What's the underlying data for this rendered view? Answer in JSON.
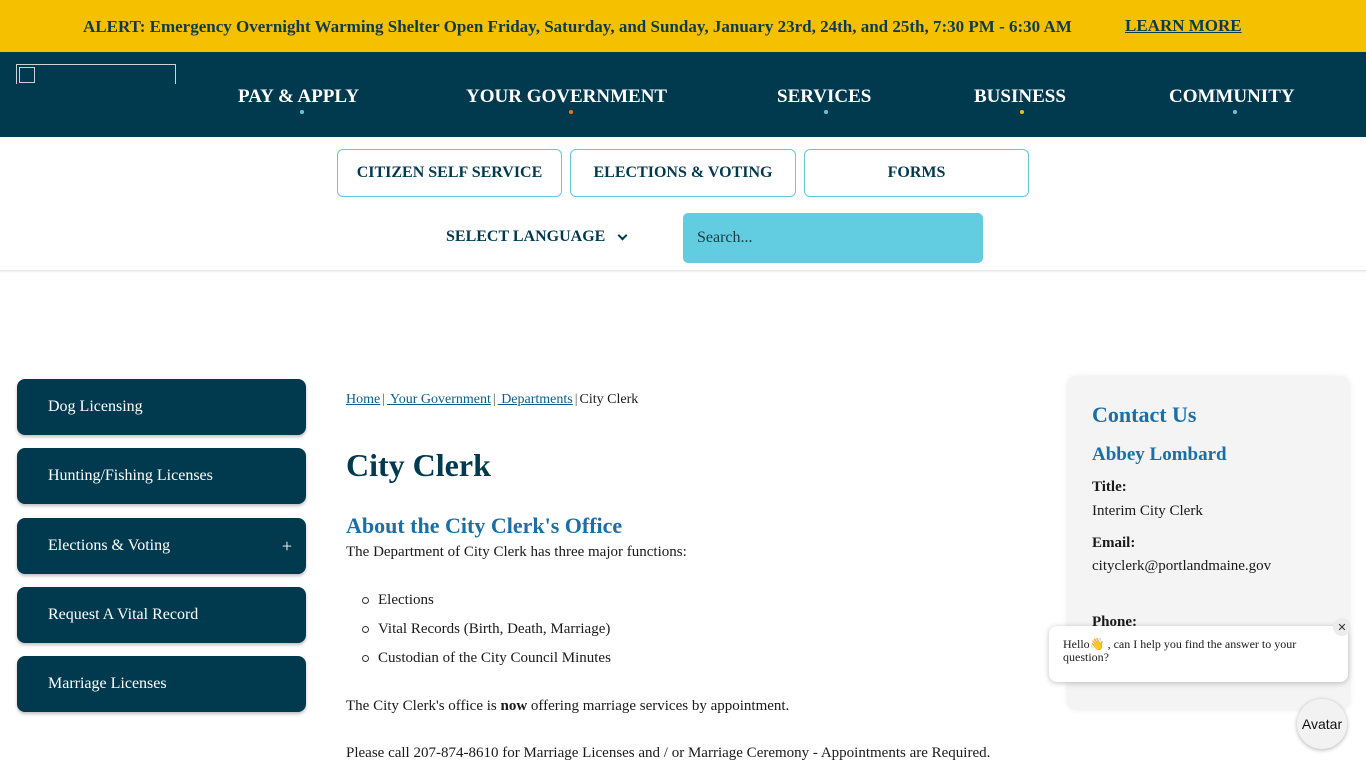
{
  "alert": {
    "text": "ALERT: Emergency Overnight Warming Shelter Open Friday, Saturday, and Sunday, January 23rd, 24th, and 25th, 7:30 PM - 6:30 AM",
    "link": "LEARN MORE"
  },
  "nav": {
    "items": [
      {
        "label": "PAY & APPLY",
        "dot_color": "#62c9dc"
      },
      {
        "label": "YOUR GOVERNMENT",
        "dot_color": "#e8742a"
      },
      {
        "label": "SERVICES",
        "dot_color": "#62c9dc"
      },
      {
        "label": "BUSINESS",
        "dot_color": "#f5c000"
      },
      {
        "label": "COMMUNITY",
        "dot_color": "#62c9dc"
      }
    ]
  },
  "quick_links": [
    "CITIZEN SELF SERVICE",
    "ELECTIONS & VOTING",
    "FORMS"
  ],
  "language": {
    "label": "SELECT LANGUAGE"
  },
  "search": {
    "placeholder": "Search..."
  },
  "sidebar": {
    "items": [
      {
        "label": "Dog Licensing"
      },
      {
        "label": "Hunting/Fishing Licenses"
      },
      {
        "label": "Elections & Voting",
        "expand": "+"
      },
      {
        "label": "Request A Vital Record"
      },
      {
        "label": "Marriage Licenses"
      }
    ]
  },
  "breadcrumb": {
    "items": [
      "Home",
      " Your Government",
      " Departments"
    ],
    "current": "City Clerk",
    "separator": "|"
  },
  "page": {
    "title": "City Clerk",
    "subtitle": "About the City Clerk's Office",
    "intro": "The Department of City Clerk has three major functions:",
    "functions": [
      "Elections",
      "Vital Records (Birth, Death, Marriage)",
      "Custodian of the City Council Minutes"
    ],
    "marriage_pre": "The City Clerk's office is ",
    "marriage_bold": "now",
    "marriage_post": " offering marriage services by appointment.",
    "call_text": "Please call 207-874-8610 for Marriage Licenses and / or Marriage Ceremony - Appointments are Required."
  },
  "contact": {
    "heading": "Contact Us",
    "name": "Abbey Lombard",
    "title_label": "Title:",
    "title_value": "Interim City Clerk",
    "email_label": "Email:",
    "email_value": "cityclerk@portlandmaine.gov",
    "phone_label": "Phone:"
  },
  "chat": {
    "message": "Hello👋 , can I help you find the answer to your question?",
    "close": "✕",
    "avatar_label": "Avatar"
  },
  "colors": {
    "alert_bg": "#f5c000",
    "nav_bg": "#013a4f",
    "accent": "#62c9dc",
    "heading_blue": "#1a6fa6"
  }
}
